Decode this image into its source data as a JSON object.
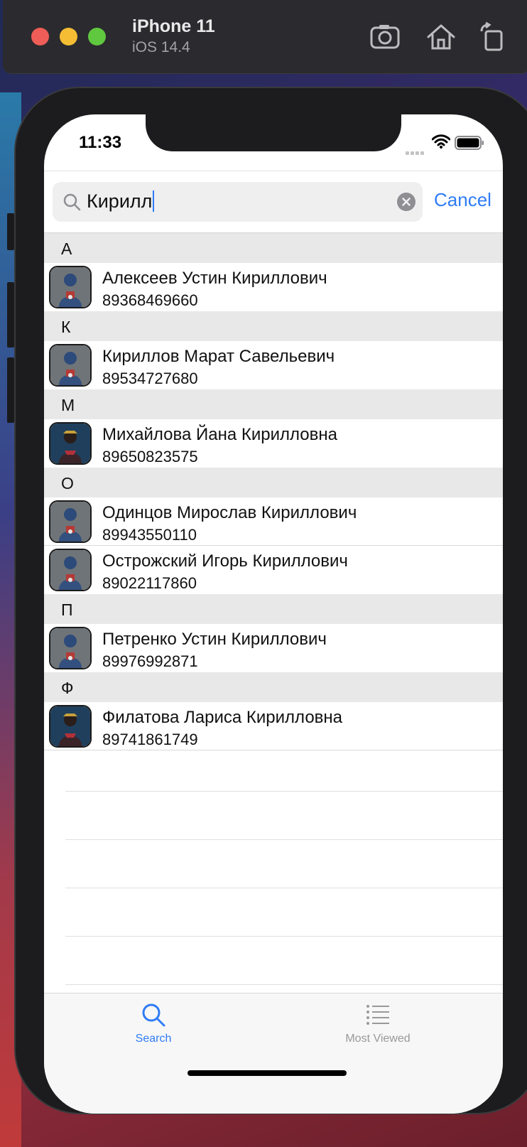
{
  "simulator": {
    "device_name": "iPhone 11",
    "os_version": "iOS 14.4",
    "toolbar_icons": [
      "screenshot-icon",
      "home-icon",
      "rotate-icon"
    ]
  },
  "status_bar": {
    "time": "11:33",
    "icons": [
      "signal-icon",
      "wifi-icon",
      "battery-icon"
    ]
  },
  "search": {
    "value": "Кирилл",
    "cancel_label": "Cancel"
  },
  "sections": [
    {
      "letter": "А",
      "contacts": [
        {
          "name": "Алексеев Устин Кириллович",
          "phone": "89368469660",
          "avatar": "captain-america"
        }
      ]
    },
    {
      "letter": "К",
      "contacts": [
        {
          "name": "Кириллов Марат Савельевич",
          "phone": "89534727680",
          "avatar": "captain-america"
        }
      ]
    },
    {
      "letter": "М",
      "contacts": [
        {
          "name": "Михайлова Йана Кирилловна",
          "phone": "89650823575",
          "avatar": "wonder-woman"
        }
      ]
    },
    {
      "letter": "О",
      "contacts": [
        {
          "name": "Одинцов Мирослав Кириллович",
          "phone": "89943550110",
          "avatar": "captain-america"
        },
        {
          "name": "Острожский Игорь Кириллович",
          "phone": "89022117860",
          "avatar": "captain-america"
        }
      ]
    },
    {
      "letter": "П",
      "contacts": [
        {
          "name": "Петренко Устин Кириллович",
          "phone": "89976992871",
          "avatar": "captain-america"
        }
      ]
    },
    {
      "letter": "Ф",
      "contacts": [
        {
          "name": "Филатова Лариса Кирилловна",
          "phone": "89741861749",
          "avatar": "wonder-woman"
        }
      ]
    }
  ],
  "tabs": [
    {
      "label": "Search",
      "icon": "search-icon",
      "selected": true
    },
    {
      "label": "Most Viewed",
      "icon": "list-icon",
      "selected": false
    }
  ],
  "colors": {
    "accent": "#2f7cf6",
    "section_bg": "#e8e8e9",
    "inactive_tab": "#999999"
  }
}
